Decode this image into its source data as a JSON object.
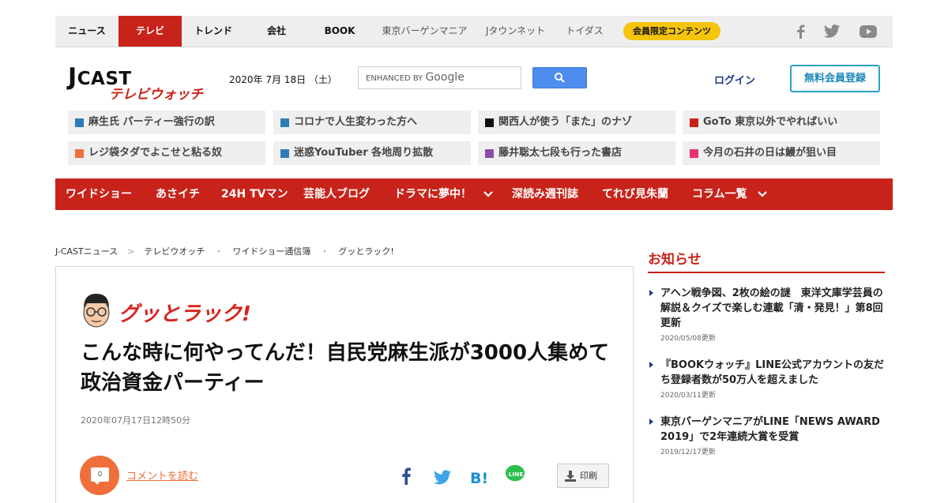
{
  "topnav": {
    "items": [
      "ニュース",
      "テレビ",
      "トレンド",
      "会社",
      "BOOK",
      "東京バーゲンマニア",
      "Jタウンネット",
      "トイダス"
    ],
    "member": "会員限定コンテンツ",
    "social": [
      "facebook-icon",
      "twitter-icon",
      "youtube-icon"
    ]
  },
  "header": {
    "logo_main": "CAST",
    "logo_j": "J",
    "logo_sub": "テレビウォッチ",
    "date": "2020年 7月 18日 （土）",
    "search_enhanced": "ENHANCED BY",
    "search_google": "Google",
    "login": "ログイン",
    "register": "無料会員登録"
  },
  "trending": [
    {
      "text": "麻生氏 パーティー強行の訳",
      "color": "#2e7bb6"
    },
    {
      "text": "コロナで人生変わった方へ",
      "color": "#2e7bb6"
    },
    {
      "text": "関西人が使う「また」のナゾ",
      "color": "#111111"
    },
    {
      "text": "GoTo 東京以外でやればいい",
      "color": "#c8231a"
    },
    {
      "text": "レジ袋タダでよこせと粘る奴",
      "color": "#ef6e3b"
    },
    {
      "text": "迷惑YouTuber 各地周り拡散",
      "color": "#2e7bb6"
    },
    {
      "text": "藤井聡太七段も行った書店",
      "color": "#8b4ea8"
    },
    {
      "text": "今月の石井の日は鰻が狙い目",
      "color": "#e8336e"
    }
  ],
  "rednav": [
    "ワイドショー",
    "あさイチ",
    "24H TVマン",
    "芸能人ブログ",
    "ドラマに夢中！",
    "深読み週刊誌",
    "てれび見朱蘭",
    "コラム一覧"
  ],
  "breadcrumb": [
    "J-CASTニュース",
    "テレビウオッチ",
    "ワイドショー通信簿",
    "グッとラック!"
  ],
  "article": {
    "program": "グッとラック!",
    "headline": "こんな時に何やってんだ！自民党麻生派が3000人集めて政治資金パーティー",
    "date": "2020年07月17日12時50分",
    "comment_count": "0",
    "comment_link": "コメントを読む",
    "print": "印刷"
  },
  "sidebar": {
    "title": "お知らせ",
    "news": [
      {
        "title": "アヘン戦争図、2枚の絵の謎　東洋文庫学芸員の解説＆クイズで楽しむ連載「清・発見！」第8回更新",
        "date": "2020/05/08更新"
      },
      {
        "title": "『BOOKウォッチ』LINE公式アカウントの友だち登録者数が50万人を超えました",
        "date": "2020/03/11更新"
      },
      {
        "title": "東京バーゲンマニアがLINE「NEWS AWARD 2019」で2年連続大賞を受賞",
        "date": "2019/12/17更新"
      }
    ]
  },
  "colors": {
    "brand_red": "#c8231a",
    "member_yellow": "#f5c40c",
    "accent_orange": "#ef6e3b",
    "search_blue": "#4e8df0"
  }
}
